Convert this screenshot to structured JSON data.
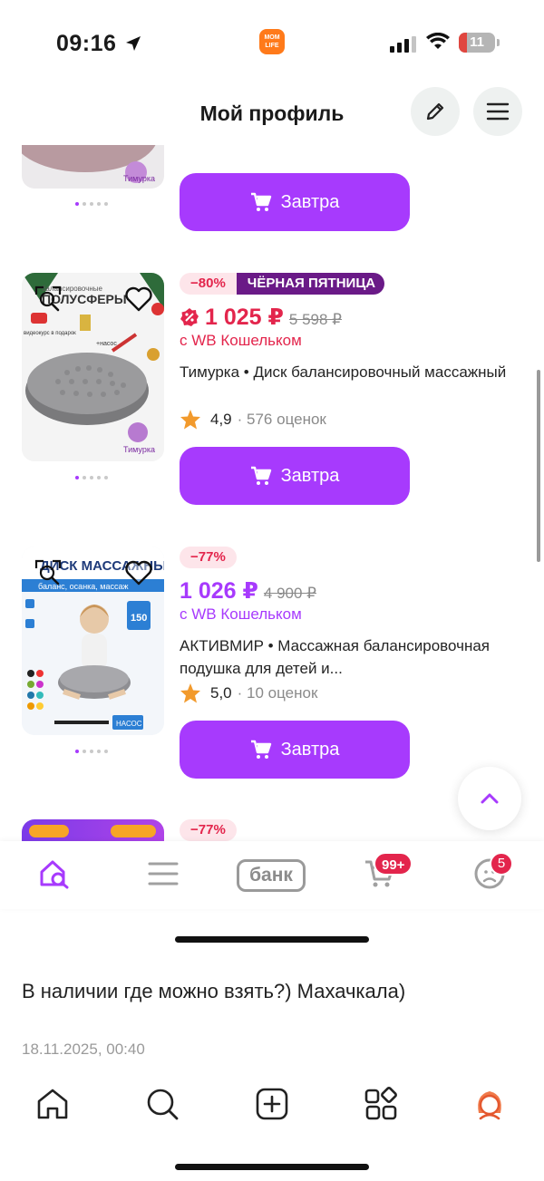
{
  "status_bar": {
    "time": "09:16",
    "app_logo": "MOM LIFE",
    "battery": "11"
  },
  "header": {
    "title": "Мой профиль",
    "edit_icon": "pencil-icon",
    "menu_icon": "hamburger-icon"
  },
  "products": [
    {
      "button_label": "Завтра"
    },
    {
      "discount": "−80%",
      "promo": "ЧЁРНАЯ ПЯТНИЦА",
      "price": "1 025 ₽",
      "old_price": "5 598 ₽",
      "wallet": "с WB Кошельком",
      "brand": "Тимурка",
      "title": "Тимурка • Диск балансировочный массажный",
      "rating": "4,9",
      "reviews": "· 576 оценок",
      "button_label": "Завтра",
      "image_text": {
        "headline": "ПОЛУСФЕРЫ",
        "small": "балансировочные",
        "video": "видеокурс в подарок",
        "pump": "+насос",
        "brand": "Тимурка"
      }
    },
    {
      "discount": "−77%",
      "price": "1 026 ₽",
      "old_price": "4 900 ₽",
      "wallet": "с WB Кошельком",
      "title": "АКТИВМИР • Массажная балансировочная подушка для детей и...",
      "rating": "5,0",
      "reviews": "· 10 оценок",
      "button_label": "Завтра",
      "image_text": {
        "headline": "ДИСК МАССАЖНЫЙ",
        "sub": "баланс, осанка, массаж",
        "badge": "150",
        "pump": "НАСОС"
      }
    },
    {
      "discount": "−77%"
    }
  ],
  "tabbar": {
    "bank_label": "банк",
    "cart_badge": "99+",
    "profile_badge": "5"
  },
  "comment": {
    "text": "В наличии где можно взять?) Махачкала)",
    "date": "18.11.2025, 00:40"
  },
  "colors": {
    "accent": "#a73afd",
    "sale": "#e3254c",
    "promo": "#6a1a87"
  }
}
